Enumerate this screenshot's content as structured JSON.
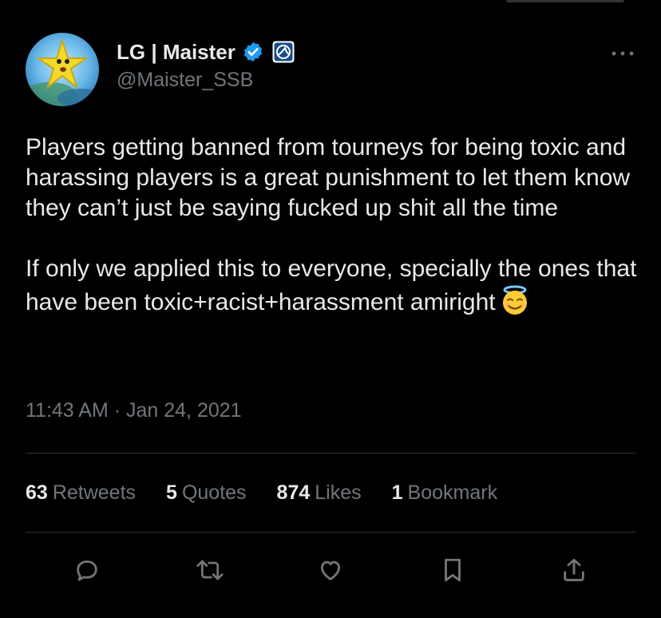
{
  "author": {
    "display_name": "LG | Maister",
    "handle": "@Maister_SSB",
    "avatar_icon": "avatar-image",
    "verified_badge_icon": "verified-check-icon",
    "affiliate_badge_icon": "liquid-logo-icon"
  },
  "tweet": {
    "paragraph_1": "Players getting banned from tourneys for being toxic and harassing players is a great punishment to let them know they can’t just be saying fucked up shit all the time",
    "paragraph_2": "If only we applied this to everyone, specially the ones that have been toxic+racist+harassment amiright",
    "emoji": "smiling-face-with-halo",
    "timestamp": "11:43 AM · Jan 24, 2021"
  },
  "stats": [
    {
      "count": "63",
      "label": "Retweets"
    },
    {
      "count": "5",
      "label": "Quotes"
    },
    {
      "count": "874",
      "label": "Likes"
    },
    {
      "count": "1",
      "label": "Bookmark"
    }
  ],
  "actions": [
    "reply-icon",
    "retweet-icon",
    "like-icon",
    "bookmark-icon",
    "share-icon"
  ],
  "colors": {
    "background": "#000000",
    "primary_text": "#e7e9ea",
    "secondary_text": "#71767b",
    "divider": "#2f3336",
    "verified_blue": "#1d9bf0"
  }
}
